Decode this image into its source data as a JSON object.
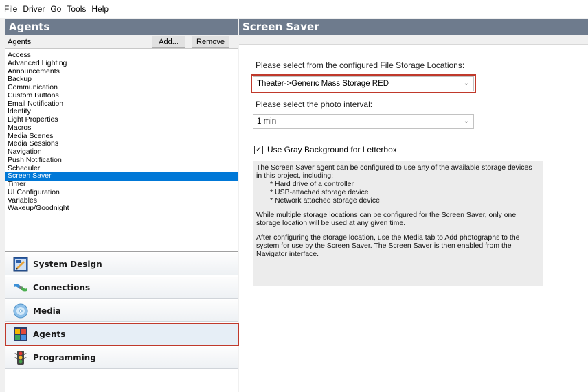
{
  "menu": [
    "File",
    "Driver",
    "Go",
    "Tools",
    "Help"
  ],
  "left": {
    "header": "Agents",
    "toolbar": {
      "title": "Agents",
      "add_label": "Add...",
      "remove_label": "Remove"
    },
    "agents": [
      "Access",
      "Advanced Lighting",
      "Announcements",
      "Backup",
      "Communication",
      "Custom Buttons",
      "Email Notification",
      "Identity",
      "Light Properties",
      "Macros",
      "Media Scenes",
      "Media Sessions",
      "Navigation",
      "Push Notification",
      "Scheduler",
      "Screen Saver",
      "Timer",
      "UI Configuration",
      "Variables",
      "Wakeup/Goodnight"
    ],
    "selected_agent": "Screen Saver",
    "nav": [
      {
        "label": "System Design",
        "icon": "system-design-icon"
      },
      {
        "label": "Connections",
        "icon": "connections-icon"
      },
      {
        "label": "Media",
        "icon": "media-icon"
      },
      {
        "label": "Agents",
        "icon": "agents-icon",
        "active": true
      },
      {
        "label": "Programming",
        "icon": "programming-icon"
      }
    ]
  },
  "right": {
    "header": "Screen Saver",
    "storage_label": "Please select from the configured File Storage Locations:",
    "storage_value": "Theater->Generic Mass Storage RED",
    "interval_label": "Please select the photo interval:",
    "interval_value": "1 min",
    "checkbox_label": "Use Gray Background for Letterbox",
    "checkbox_checked": true,
    "info_intro": "The Screen Saver agent can be configured to use any of the available storage devices in this project, including:",
    "info_items": [
      "Hard drive of a controller",
      "USB-attached storage device",
      "Network attached storage device"
    ],
    "info_para2": "While multiple storage locations can be configured for the Screen Saver, only one storage location will be used at any given time.",
    "info_para3": "After configuring the storage location, use the Media tab to Add photographs to the system for use by the Screen Saver.  The Screen Saver is then enabled from the Navigator interface."
  },
  "colors": {
    "header_bg": "#6e7b8d",
    "selection": "#0078d7",
    "highlight_outline": "#c0392b"
  }
}
